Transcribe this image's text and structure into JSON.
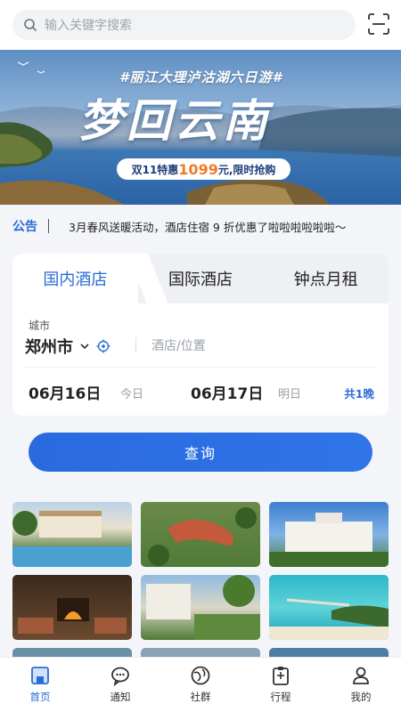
{
  "search": {
    "placeholder": "输入关键字搜索",
    "icon": "search-icon",
    "scan_icon": "scan-icon"
  },
  "banner": {
    "subtitle": "#丽江大理泸沽湖六日游#",
    "title": "梦回云南",
    "promo_prefix": "双11特惠",
    "promo_price": "1099",
    "promo_suffix": "元,限时抢购"
  },
  "notice": {
    "tag": "公告",
    "text": "3月春风送暖活动，酒店住宿 9 折优惠了啦啦啦啦啦啦～"
  },
  "booking": {
    "tabs": [
      {
        "label": "国内酒店",
        "active": true
      },
      {
        "label": "国际酒店",
        "active": false
      },
      {
        "label": "钟点月租",
        "active": false
      }
    ],
    "city_label": "城市",
    "city": "郑州市",
    "hotel_placeholder": "酒店/位置",
    "checkin": "06月16日",
    "checkin_tag": "今日",
    "checkout": "06月17日",
    "checkout_tag": "明日",
    "nights": "共1晚"
  },
  "query_button": "查询",
  "nav": {
    "items": [
      {
        "label": "首页",
        "icon": "home-icon",
        "active": true
      },
      {
        "label": "通知",
        "icon": "message-icon",
        "active": false
      },
      {
        "label": "社群",
        "icon": "community-icon",
        "active": false
      },
      {
        "label": "行程",
        "icon": "itinerary-icon",
        "active": false
      },
      {
        "label": "我的",
        "icon": "profile-icon",
        "active": false
      }
    ]
  },
  "colors": {
    "accent": "#2a6bd8",
    "promo_price": "#f07b23",
    "background": "#f3f5f9"
  }
}
